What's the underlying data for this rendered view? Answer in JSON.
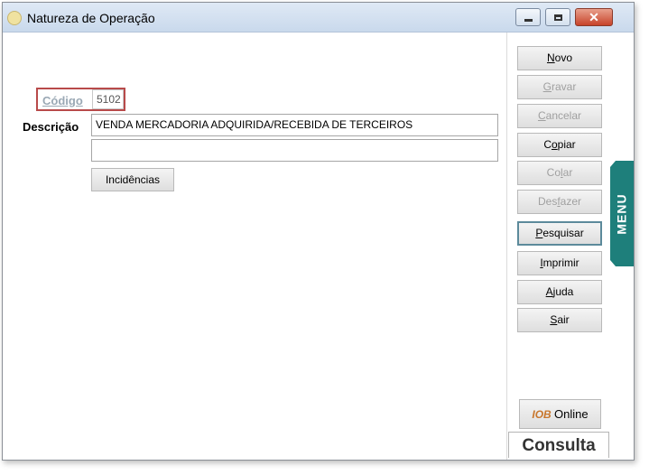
{
  "window": {
    "title": "Natureza de Operação",
    "controls": {
      "minimize": "minimize-icon",
      "maximize": "maximize-icon",
      "close": "close-icon"
    }
  },
  "form": {
    "codigo_label": "Código",
    "codigo_value": "5102",
    "descricao_label": "Descrição",
    "descricao_value": "VENDA MERCADORIA ADQUIRIDA/RECEBIDA DE TERCEIROS",
    "descricao2_value": "",
    "incidencias_label": "Incidências"
  },
  "toolbar": {
    "items": [
      {
        "pre": "",
        "key": "N",
        "post": "ovo",
        "enabled": true
      },
      {
        "pre": "",
        "key": "G",
        "post": "ravar",
        "enabled": false
      },
      {
        "pre": "",
        "key": "C",
        "post": "ancelar",
        "enabled": false
      },
      {
        "pre": "C",
        "key": "o",
        "post": "piar",
        "enabled": true
      },
      {
        "pre": "Co",
        "key": "l",
        "post": "ar",
        "enabled": false
      },
      {
        "pre": "Des",
        "key": "f",
        "post": "azer",
        "enabled": false
      },
      {
        "pre": "",
        "key": "P",
        "post": "esquisar",
        "enabled": true,
        "focused": true
      },
      {
        "pre": "",
        "key": "I",
        "post": "mprimir",
        "enabled": true
      },
      {
        "pre": "",
        "key": "A",
        "post": "juda",
        "enabled": true
      },
      {
        "pre": "",
        "key": "S",
        "post": "air",
        "enabled": true
      }
    ]
  },
  "menu_tab": {
    "label": "MENU",
    "color": "#1e7f7b"
  },
  "iob": {
    "brand": "IOB",
    "label": "Online"
  },
  "status": {
    "consulta_label": "Consulta"
  },
  "colors": {
    "titlebar": "#c9d9ec",
    "highlight_border": "#b84a4a",
    "menu_tab": "#1e7f7b",
    "disabled_text": "#a0a0a0"
  }
}
